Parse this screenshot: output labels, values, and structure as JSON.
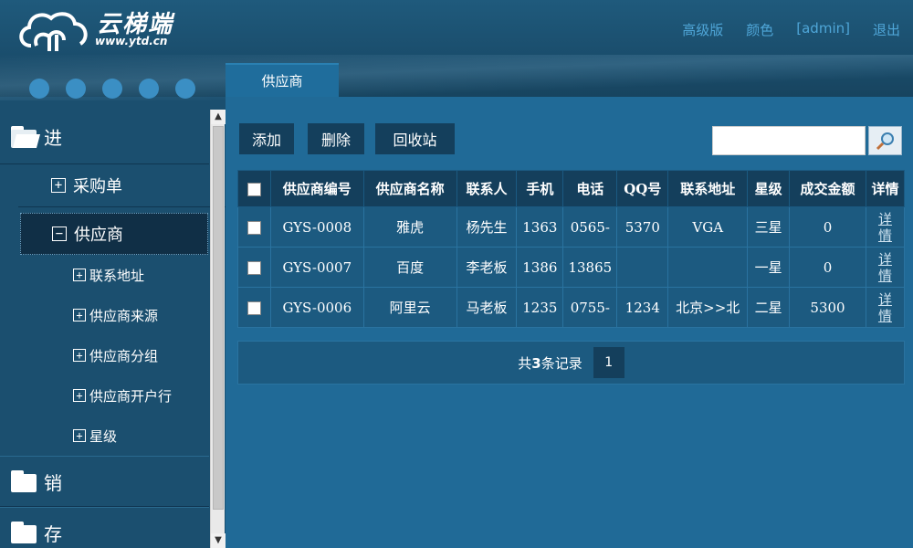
{
  "header": {
    "logo_text": "云梯端",
    "logo_url": "www.ytd.cn",
    "links": [
      "高级版",
      "颜色",
      "[admin]",
      "退出"
    ]
  },
  "tabs": {
    "active": "供应商"
  },
  "sidebar": {
    "groups": [
      {
        "label": "进",
        "open": true
      },
      {
        "label": "销",
        "open": false
      },
      {
        "label": "存",
        "open": false
      }
    ],
    "items": [
      {
        "label": "采购单",
        "state": "+"
      },
      {
        "label": "供应商",
        "state": "−",
        "selected": true
      }
    ],
    "subitems": [
      "联系地址",
      "供应商来源",
      "供应商分组",
      "供应商开户行",
      "星级"
    ]
  },
  "toolbar": {
    "add": "添加",
    "delete": "删除",
    "recycle": "回收站",
    "search_value": ""
  },
  "table": {
    "headers": [
      "供应商编号",
      "供应商名称",
      "联系人",
      "手机",
      "电话",
      "QQ号",
      "联系地址",
      "星级",
      "成交金额",
      "详情"
    ],
    "rows": [
      [
        "GYS-0008",
        "雅虎",
        "杨先生",
        "1363",
        "0565-",
        "5370",
        "VGA",
        "三星",
        "0",
        "详情"
      ],
      [
        "GYS-0007",
        "百度",
        "李老板",
        "1386",
        "13865",
        "",
        "",
        "一星",
        "0",
        "详情"
      ],
      [
        "GYS-0006",
        "阿里云",
        "马老板",
        "1235",
        "0755-",
        "1234",
        "北京>>北",
        "二星",
        "5300",
        "详情"
      ]
    ]
  },
  "pager": {
    "summary_prefix": "共",
    "count": "3",
    "summary_suffix": "条记录",
    "current_page": "1"
  },
  "colors": {
    "header_bg": "#1f5a7c",
    "sidebar_bg": "#1b4f6f",
    "main_bg": "#206a97",
    "link": "#4fa6d8"
  }
}
